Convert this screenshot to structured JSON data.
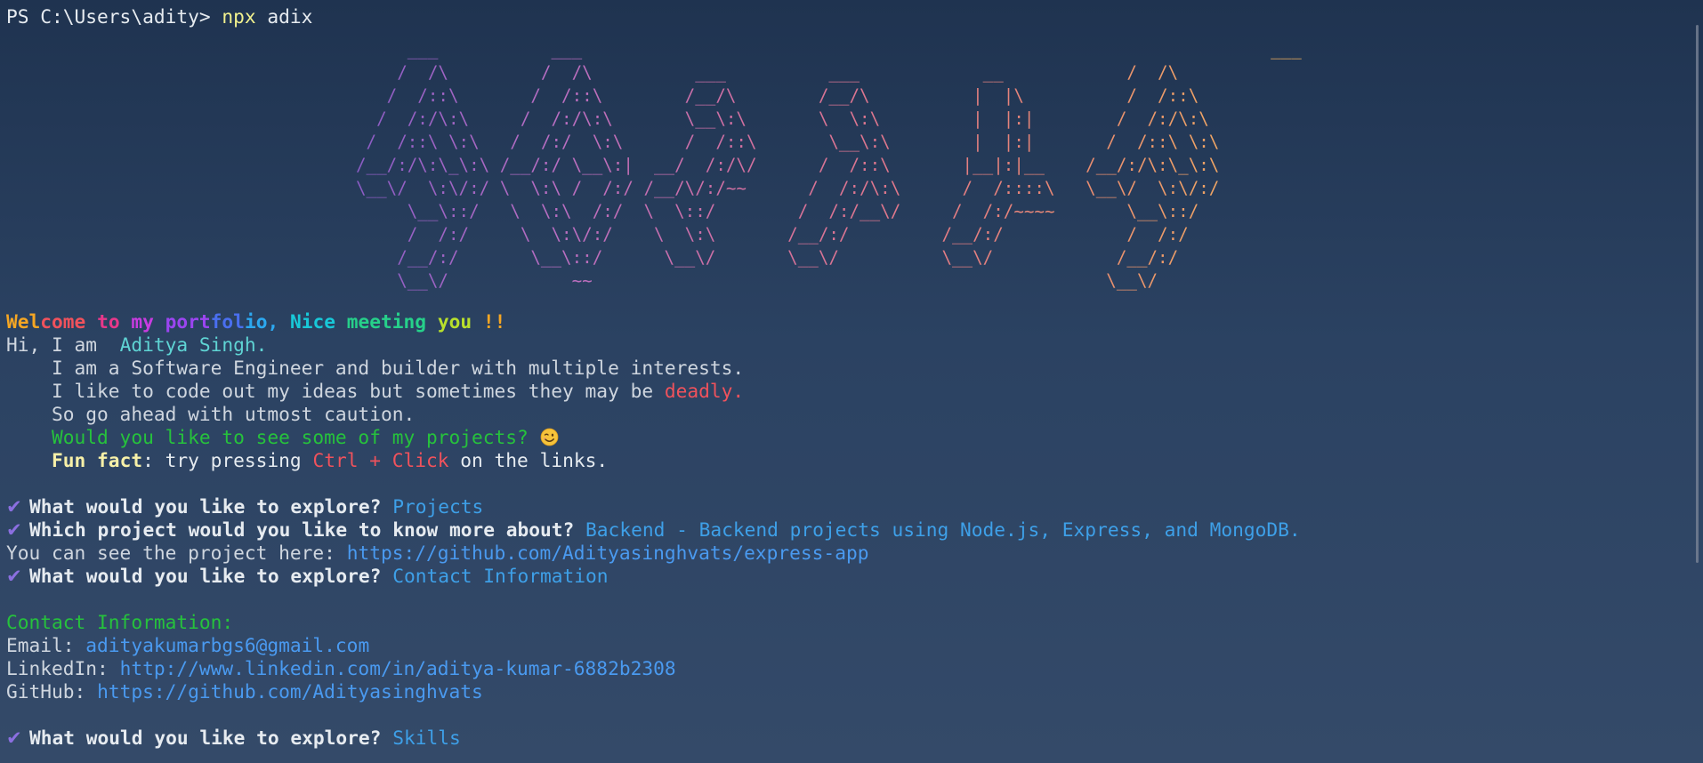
{
  "prompt": {
    "ps_prefix": "PS C:\\Users\\adity> ",
    "command": "npx",
    "argument": " adix"
  },
  "banner": {
    "ascii_art": "     ___           ___                                                                   ___     \n    /  /\\         /  /\\          ___          ___            __            /  /\\    \n   /  /::\\       /  /::\\        /__/\\        /__/\\          |  |\\          /  /::\\   \n  /  /:/\\:\\     /  /:/\\:\\       \\__\\:\\       \\  \\:\\         |  |:|        /  /:/\\:\\  \n /  /::\\ \\:\\   /  /:/  \\:\\      /  /::\\       \\__\\:\\        |  |:|       /  /::\\ \\:\\ \n/__/:/\\:\\_\\:\\ /__/:/ \\__\\:|  __/  /:/\\/      /  /::\\       |__|:|__    /__/:/\\:\\_\\:\\\n\\__\\/  \\:\\/:/ \\  \\:\\ /  /:/ /__/\\/:/~~      /  /:/\\:\\      /  /::::\\   \\__\\/  \\:\\/:/\n     \\__\\::/   \\  \\:\\  /:/  \\  \\::/        /  /:/__\\/     /  /:/~~~~       \\__\\::/ \n     /  /:/     \\  \\:\\/:/    \\  \\:\\       /__/:/         /__/:/            /  /:/  \n    /__/:/       \\__\\::/      \\__\\/       \\__\\/          \\__\\/            /__/:/   \n    \\__\\/            ~~                                                  \\__\\/    "
  },
  "welcome": {
    "segments": [
      {
        "text": "Wel",
        "color": "#f5a623"
      },
      {
        "text": "come ",
        "color": "#f0525c"
      },
      {
        "text": "to ",
        "color": "#e8388a"
      },
      {
        "text": "my ",
        "color": "#c83ce0"
      },
      {
        "text": "port",
        "color": "#9b45f0"
      },
      {
        "text": "fol",
        "color": "#4a6ff0"
      },
      {
        "text": "io, ",
        "color": "#2ca8f0"
      },
      {
        "text": "Nice ",
        "color": "#18c8d8"
      },
      {
        "text": "meeting ",
        "color": "#26d08a"
      },
      {
        "text": "you ",
        "color": "#b8e02c"
      },
      {
        "text": "!!",
        "color": "#f5a623"
      }
    ]
  },
  "intro": {
    "greeting": "Hi, I am  ",
    "name": "Aditya Singh.",
    "line1": "    I am a Software Engineer and builder with multiple interests.",
    "line2_a": "    I like to code out my ideas but sometimes they may be ",
    "line2_b": "deadly.",
    "line3": "    So go ahead with utmost caution.",
    "line4": "    Would you like to see some of my projects? ",
    "fun_indent": "    ",
    "fun_label": "Fun fact",
    "fun_text": ": try pressing ",
    "fun_keys": "Ctrl + Click",
    "fun_tail": " on the links."
  },
  "session": {
    "check_glyph": "✔",
    "q1": "What would you like to explore? ",
    "a1": "Projects",
    "q2": "Which project would you like to know more about? ",
    "a2": "Backend - Backend projects using Node.js, Express, and MongoDB.",
    "project_label": "You can see the project here: ",
    "project_url": "https://github.com/Adityasinghvats/express-app",
    "q3": "What would you like to explore? ",
    "a3": "Contact Information",
    "contact_heading": "Contact Information:",
    "email_label": "Email: ",
    "email": "adityakumarbgs6@gmail.com",
    "linkedin_label": "LinkedIn: ",
    "linkedin": "http://www.linkedin.com/in/aditya-kumar-6882b2308",
    "github_label": "GitHub: ",
    "github": "https://github.com/Adityasinghvats",
    "q4": "What would you like to explore? ",
    "a4": "Skills"
  },
  "icons": {
    "check": "checkmark-icon",
    "emoji": "winking-face-emoji-icon"
  },
  "colors": {
    "background": "#2b4262",
    "text": "#cfd6df",
    "accent_blue": "#3ea0e8",
    "link": "#4a9af0",
    "green": "#26c23c",
    "red": "#f0525c",
    "check": "#8b6fe0"
  }
}
